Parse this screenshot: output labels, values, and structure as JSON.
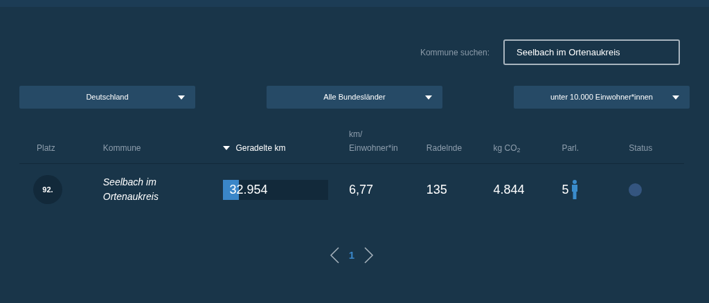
{
  "search": {
    "label": "Kommune suchen:",
    "value": "Seelbach im Ortenaukreis"
  },
  "filters": [
    "Deutschland",
    "Alle Bundesländer",
    "unter 10.000 Einwohner*innen"
  ],
  "table": {
    "columns": [
      {
        "label": "Platz",
        "sorted": false
      },
      {
        "label": "Kommune",
        "sorted": false
      },
      {
        "label": "Geradelte km",
        "sorted": true
      },
      {
        "label": "km/ Einwohner*in",
        "sorted": false
      },
      {
        "label": "Radelnde",
        "sorted": false
      },
      {
        "label": "kg CO$_{2}$",
        "sorted": false
      },
      {
        "label": "Parl.",
        "sorted": false
      },
      {
        "label": "Status",
        "sorted": false
      }
    ],
    "rows": [
      {
        "rank": "92.",
        "name": "Seelbach im Ortenaukreis",
        "km": "32.954",
        "level": 0.15,
        "km_per_resident": "6,77",
        "cyclists": "135",
        "co2": "4.844",
        "parl": "5",
        "color": "#34557f"
      }
    ]
  },
  "pagination": {
    "pages": [
      {
        "label": "1",
        "selected": true
      }
    ]
  }
}
